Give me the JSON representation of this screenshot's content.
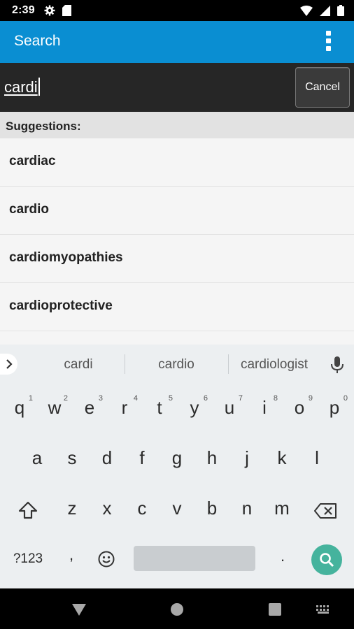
{
  "status_bar": {
    "time": "2:39",
    "icons": [
      "gear-icon",
      "sd-card-icon",
      "wifi-icon",
      "signal-icon",
      "battery-icon"
    ]
  },
  "app_bar": {
    "title": "Search",
    "menu_icon": "overflow-menu-icon",
    "color": "#0a8ed2"
  },
  "search": {
    "value": "cardi",
    "cancel_label": "Cancel"
  },
  "suggestions": {
    "header": "Suggestions:",
    "items": [
      "cardiac",
      "cardio",
      "cardiomyopathies",
      "cardioprotective"
    ]
  },
  "keyboard": {
    "strip_words": [
      "cardi",
      "cardio",
      "cardiologist"
    ],
    "row1": [
      {
        "key": "q",
        "hint": "1"
      },
      {
        "key": "w",
        "hint": "2"
      },
      {
        "key": "e",
        "hint": "3"
      },
      {
        "key": "r",
        "hint": "4"
      },
      {
        "key": "t",
        "hint": "5"
      },
      {
        "key": "y",
        "hint": "6"
      },
      {
        "key": "u",
        "hint": "7"
      },
      {
        "key": "i",
        "hint": "8"
      },
      {
        "key": "o",
        "hint": "9"
      },
      {
        "key": "p",
        "hint": "0"
      }
    ],
    "row2": [
      "a",
      "s",
      "d",
      "f",
      "g",
      "h",
      "j",
      "k",
      "l"
    ],
    "row3": [
      "z",
      "x",
      "c",
      "v",
      "b",
      "n",
      "m"
    ],
    "symbols_label": "?123",
    "comma": ",",
    "period": ".",
    "accent_color": "#45b39d"
  }
}
